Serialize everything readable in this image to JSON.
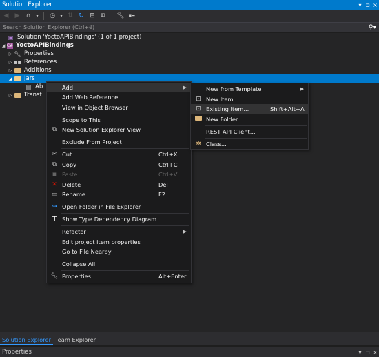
{
  "window": {
    "title": "Solution Explorer",
    "controls": [
      "▾",
      "⊐",
      "×"
    ]
  },
  "toolbar": {
    "icons": [
      "back-icon",
      "forward-icon",
      "home-icon",
      "history-icon",
      "pending-changes-icon",
      "sync-icon",
      "collapse-all-icon",
      "show-all-files-icon",
      "properties-wrench-icon",
      "preview-icon"
    ]
  },
  "search": {
    "placeholder": "Search Solution Explorer (Ctrl+ë)"
  },
  "tree": {
    "solution": "Solution 'YoctoAPIBindings' (1 of 1 project)",
    "project": "YoctoAPIBindings",
    "items": {
      "properties": "Properties",
      "references": "References",
      "additions": "Additions",
      "jars": "Jars",
      "ab_child": "Ab",
      "transforms": "Transf"
    }
  },
  "context_menu": {
    "add": "Add",
    "add_web_reference": "Add Web Reference...",
    "view_in_object_browser": "View in Object Browser",
    "scope_to_this": "Scope to This",
    "new_solution_explorer_view": "New Solution Explorer View",
    "exclude_from_project": "Exclude From Project",
    "cut": "Cut",
    "cut_shortcut": "Ctrl+X",
    "copy": "Copy",
    "copy_shortcut": "Ctrl+C",
    "paste": "Paste",
    "paste_shortcut": "Ctrl+V",
    "delete": "Delete",
    "delete_shortcut": "Del",
    "rename": "Rename",
    "rename_shortcut": "F2",
    "open_folder": "Open Folder in File Explorer",
    "show_type_dependency": "Show Type Dependency Diagram",
    "refactor": "Refactor",
    "edit_project_item_properties": "Edit project item properties",
    "go_to_file_nearby": "Go to File Nearby",
    "collapse_all": "Collapse All",
    "properties": "Properties",
    "properties_shortcut": "Alt+Enter"
  },
  "add_submenu": {
    "new_from_template": "New from Template",
    "new_item": "New Item...",
    "existing_item": "Existing Item...",
    "existing_item_shortcut": "Shift+Alt+A",
    "new_folder": "New Folder",
    "rest_api_client": "REST API Client...",
    "class": "Class..."
  },
  "bottom_tabs": {
    "solution_explorer": "Solution Explorer",
    "team_explorer": "Team Explorer"
  },
  "properties_panel": {
    "title": "Properties"
  },
  "colors": {
    "accent": "#007acc",
    "menu_bg": "#1b1b1c",
    "menu_highlight": "#333334",
    "folder": "#dcb67a",
    "delete_red": "#e51400"
  }
}
